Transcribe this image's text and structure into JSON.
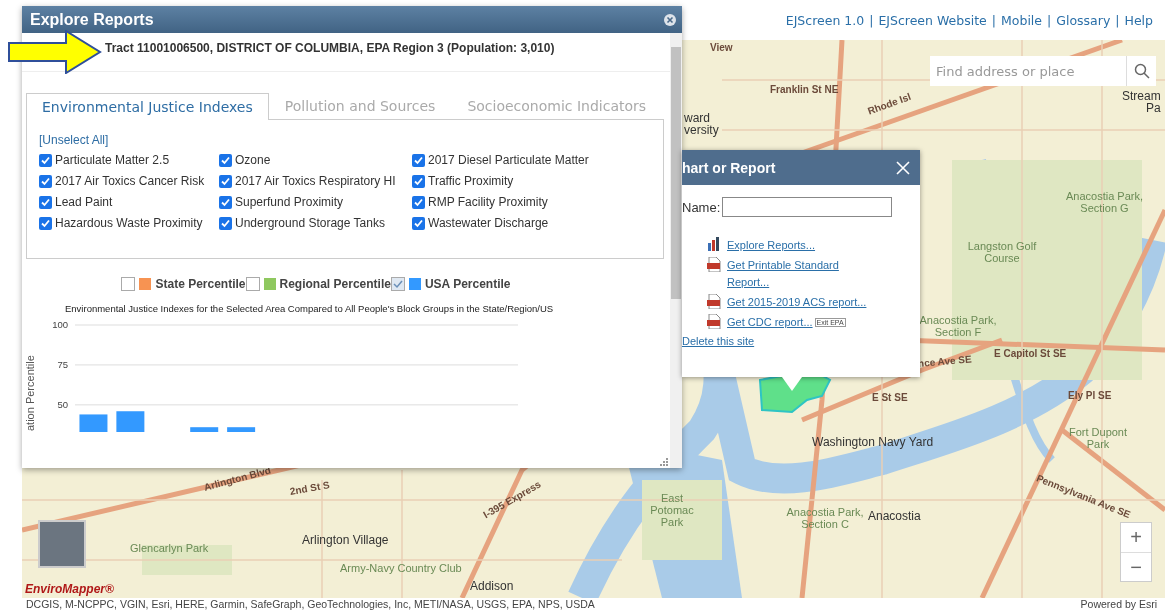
{
  "header_links": [
    {
      "label": "EJScreen 1.0"
    },
    {
      "label": "EJScreen Website"
    },
    {
      "label": "Mobile"
    },
    {
      "label": "Glossary"
    },
    {
      "label": "Help"
    }
  ],
  "header_separator": "|",
  "search": {
    "placeholder": "Find address or place"
  },
  "map": {
    "labels": [
      {
        "text": "View",
        "kind": "road"
      },
      {
        "text": "Franklin St NE",
        "kind": "road"
      },
      {
        "text": "Rhode Isl",
        "kind": "road"
      },
      {
        "text": "ward",
        "kind": "place"
      },
      {
        "text": "versity",
        "kind": "place"
      },
      {
        "text": "Stream",
        "kind": "place"
      },
      {
        "text": "Pa",
        "kind": "place"
      },
      {
        "text": "Anacostia Park, Section G",
        "kind": "park"
      },
      {
        "text": "Langston Golf Course",
        "kind": "park"
      },
      {
        "text": "Anacostia Park, Section F",
        "kind": "park"
      },
      {
        "text": "E Capitol St SE",
        "kind": "road"
      },
      {
        "text": "nce Ave SE",
        "kind": "road"
      },
      {
        "text": "Washington Navy Yard",
        "kind": "place"
      },
      {
        "text": "Fort Dupont Park",
        "kind": "park"
      },
      {
        "text": "Arlington Blvd",
        "kind": "road"
      },
      {
        "text": "2nd St S",
        "kind": "road"
      },
      {
        "text": "I-395 Express",
        "kind": "road"
      },
      {
        "text": "East Potomac Park",
        "kind": "park"
      },
      {
        "text": "Anacostia Park, Section C",
        "kind": "park"
      },
      {
        "text": "Anacostia",
        "kind": "place"
      },
      {
        "text": "Pennsylvania Ave SE",
        "kind": "road"
      },
      {
        "text": "Glencarlyn Park",
        "kind": "park"
      },
      {
        "text": "Arlington Village",
        "kind": "place"
      },
      {
        "text": "Army-Navy Country Club",
        "kind": "park"
      },
      {
        "text": "Addison",
        "kind": "place"
      },
      {
        "text": "Ely Pl SE",
        "kind": "road"
      },
      {
        "text": "E St SE",
        "kind": "road"
      }
    ],
    "zoom_buttons": [
      "+",
      "−"
    ],
    "logo": "EnviroMapper®",
    "attribution": "DCGIS, M-NCPPC, VGIN, Esri, HERE, Garmin, SafeGraph, GeoTechnologies, Inc, METI/NASA, USGS, EPA, NPS, USDA",
    "powered_by": "Powered by Esri"
  },
  "explore_reports": {
    "title": "Explore Reports",
    "location": "Tract 11001006500, DISTRICT OF COLUMBIA, EPA Region 3 (Population: 3,010)",
    "tabs": [
      {
        "label": "Environmental Justice Indexes",
        "selected": true
      },
      {
        "label": "Pollution and Sources",
        "selected": false
      },
      {
        "label": "Socioeconomic Indicators",
        "selected": false
      }
    ],
    "unselect_all": "[Unselect All]",
    "indicators": [
      {
        "label": "Particulate Matter 2.5",
        "checked": true
      },
      {
        "label": "Ozone",
        "checked": true
      },
      {
        "label": "2017 Diesel Particulate Matter",
        "checked": true
      },
      {
        "label": "2017 Air Toxics Cancer Risk",
        "checked": true
      },
      {
        "label": "2017 Air Toxics Respiratory HI",
        "checked": true
      },
      {
        "label": "Traffic Proximity",
        "checked": true
      },
      {
        "label": "Lead Paint",
        "checked": true
      },
      {
        "label": "Superfund Proximity",
        "checked": true
      },
      {
        "label": "RMP Facility Proximity",
        "checked": true
      },
      {
        "label": "Hazardous Waste Proximity",
        "checked": true
      },
      {
        "label": "Underground Storage Tanks",
        "checked": true
      },
      {
        "label": "Wastewater Discharge",
        "checked": true
      }
    ],
    "legend": [
      {
        "label": "State Percentile",
        "checked": false,
        "color": "#f79352"
      },
      {
        "label": "Regional Percentile",
        "checked": false,
        "color": "#8fc85f"
      },
      {
        "label": "USA Percentile",
        "checked": true,
        "color": "#3399ff"
      }
    ],
    "chart_data": {
      "type": "bar",
      "title": "Environmental Justice Indexes for the Selected Area Compared to All People's Block Groups in the State/Region/US",
      "ylabel": "ation Percentile",
      "ylim": [
        33,
        100
      ],
      "yticks": [
        50,
        75,
        100
      ],
      "series": [
        {
          "color": "#3399ff",
          "values": [
            44,
            46,
            null,
            36,
            36,
            null,
            null,
            null,
            null,
            null,
            null,
            null
          ]
        }
      ]
    }
  },
  "popup": {
    "title": "hart or Report",
    "name_label": "Name:",
    "links": [
      {
        "label": "Explore Reports...",
        "kind": "chart"
      },
      {
        "label": "Get Printable Standard Report...",
        "kind": "pdf"
      },
      {
        "label": "Get 2015-2019 ACS report...",
        "kind": "pdf"
      },
      {
        "label": "Get CDC report...",
        "kind": "pdf",
        "badge": "Exit EPA"
      }
    ],
    "delete_link": "Delete this site"
  }
}
